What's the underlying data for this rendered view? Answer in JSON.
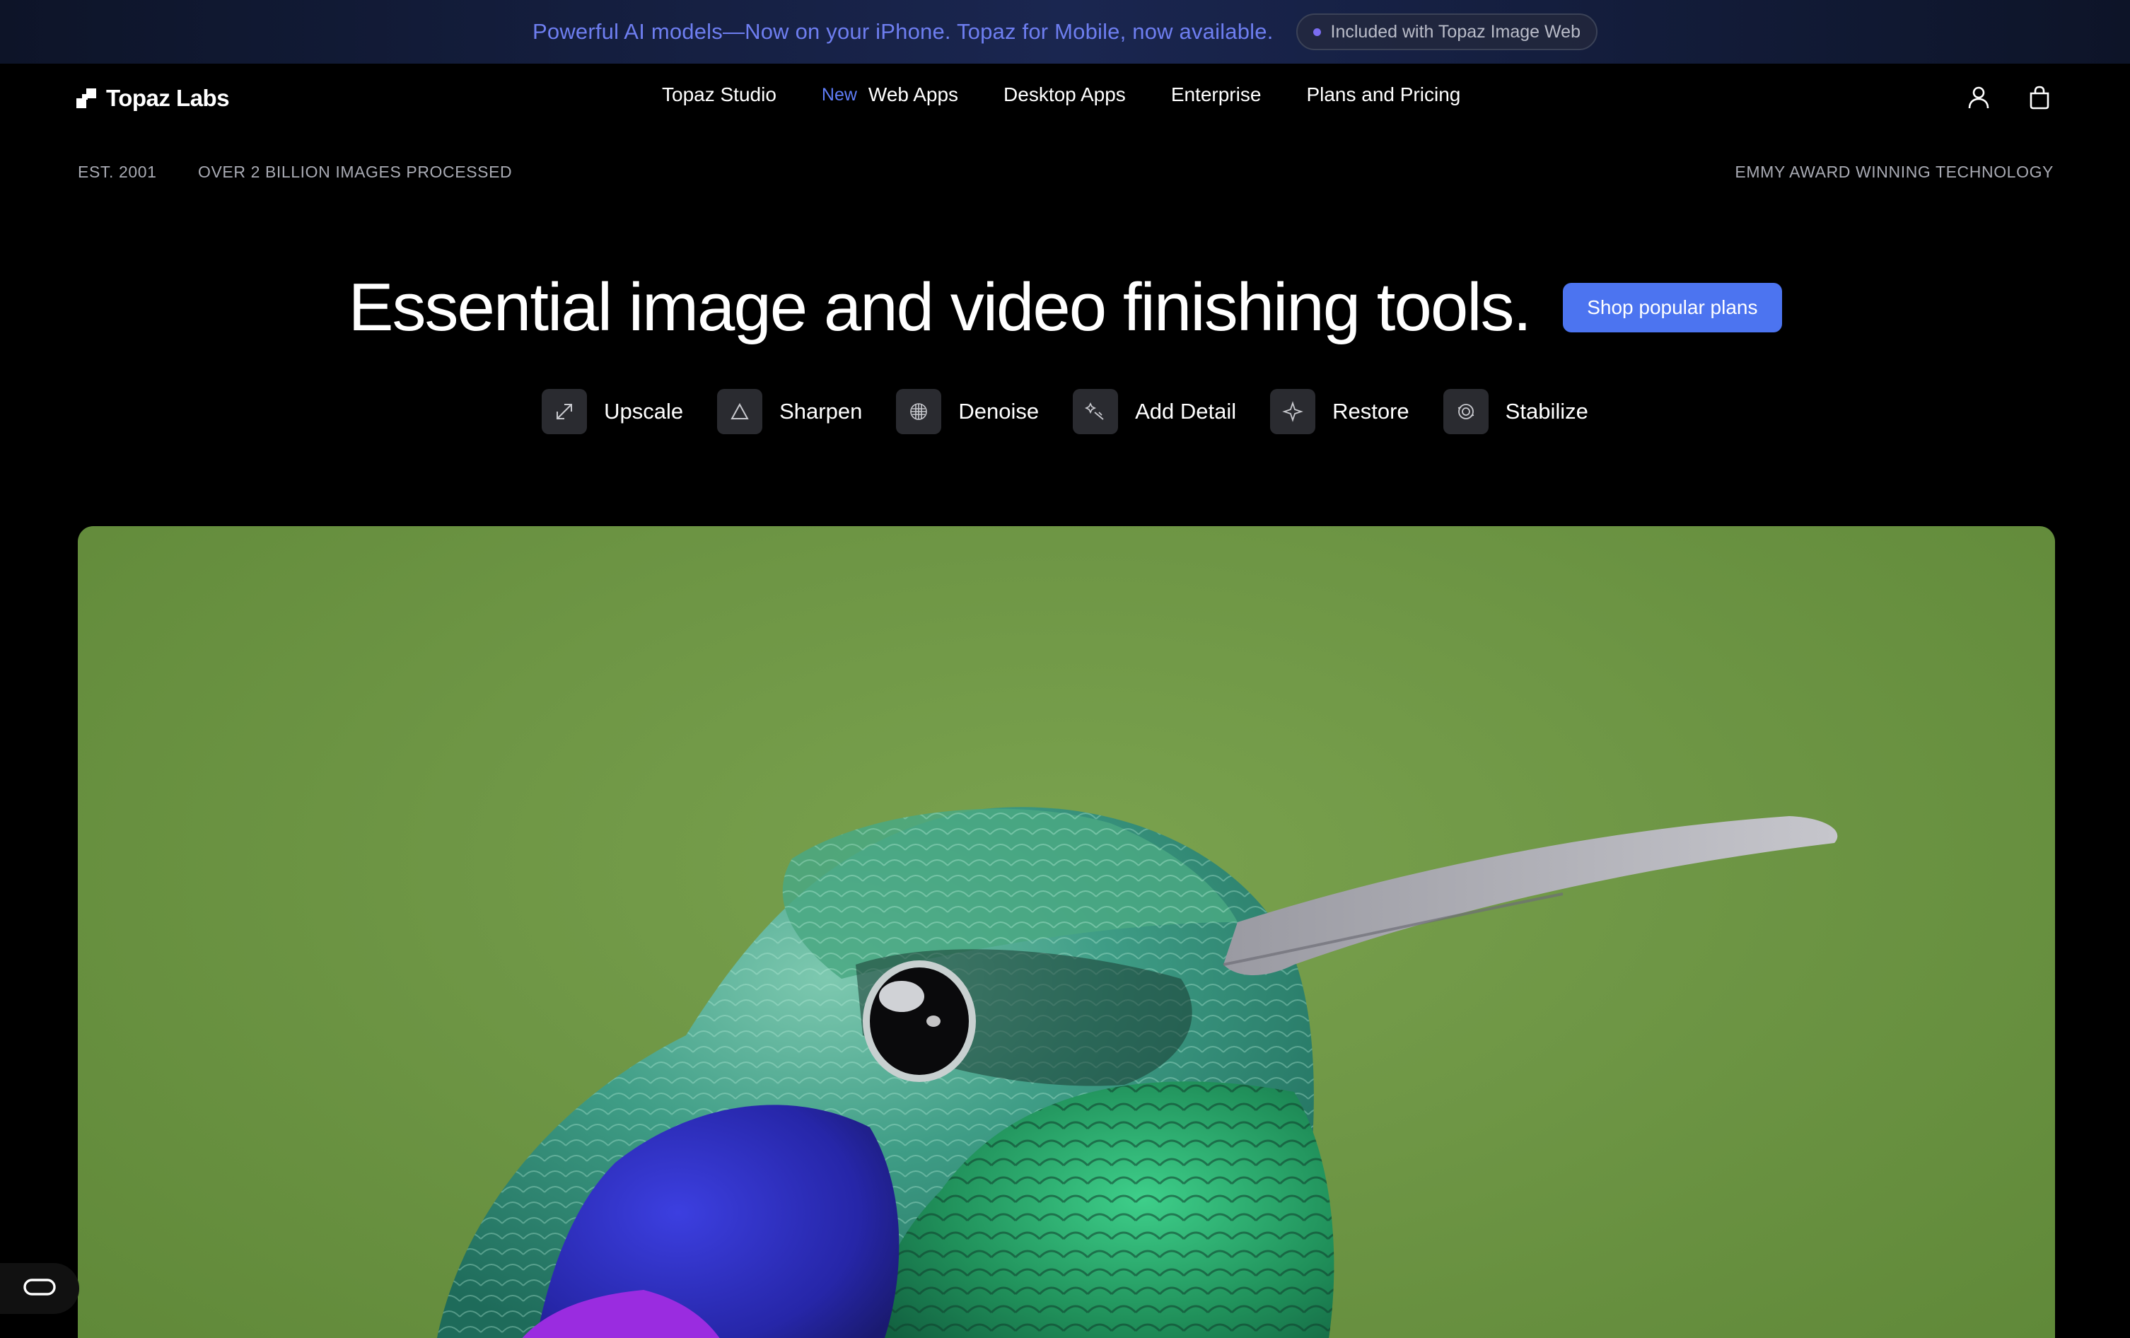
{
  "promo": {
    "text": "Powerful AI models—Now on your iPhone. Topaz for Mobile, now available.",
    "pill": "Included with Topaz Image Web"
  },
  "nav": {
    "logo": "Topaz Labs",
    "links": [
      {
        "label": "Topaz Studio"
      },
      {
        "badge": "New",
        "label": "Web Apps"
      },
      {
        "label": "Desktop Apps"
      },
      {
        "label": "Enterprise"
      },
      {
        "label": "Plans and Pricing"
      }
    ],
    "icons": [
      "account-icon",
      "cart-icon"
    ]
  },
  "stats": {
    "est": "EST. 2001",
    "images": "OVER 2 BILLION IMAGES PROCESSED",
    "emmy": "EMMY AWARD WINNING TECHNOLOGY"
  },
  "hero": {
    "title": "Essential image and video finishing tools.",
    "cta": "Shop popular plans"
  },
  "tools": [
    {
      "label": "Upscale",
      "icon": "upscale-icon"
    },
    {
      "label": "Sharpen",
      "icon": "sharpen-icon"
    },
    {
      "label": "Denoise",
      "icon": "denoise-icon"
    },
    {
      "label": "Add Detail",
      "icon": "add-detail-icon"
    },
    {
      "label": "Restore",
      "icon": "restore-icon"
    },
    {
      "label": "Stabilize",
      "icon": "stabilize-icon"
    }
  ],
  "colors": {
    "accent": "#4c74f0",
    "promo_text": "#6e7ef0",
    "background": "#000000"
  }
}
